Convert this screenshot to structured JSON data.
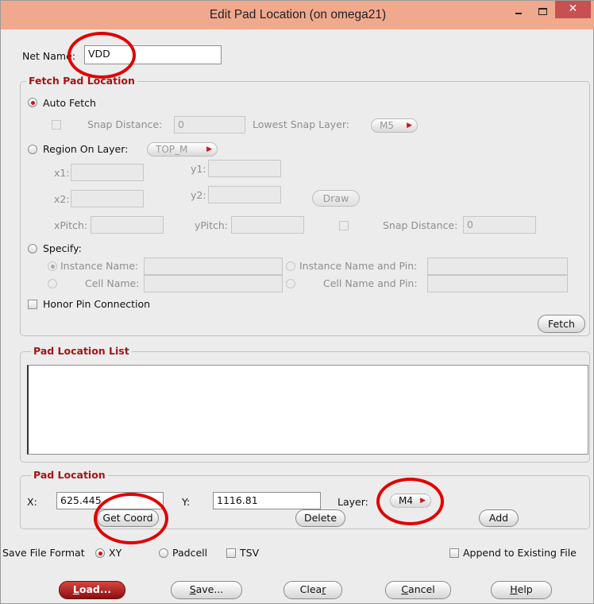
{
  "window": {
    "title": "Edit Pad Location (on omega21)",
    "close_glyph": "✕"
  },
  "net_name": {
    "label": "Net Name:",
    "value": "VDD"
  },
  "fetch_group": {
    "title": "Fetch Pad Location",
    "auto_fetch": {
      "label": "Auto Fetch",
      "selected": true
    },
    "snap_distance": {
      "label": "Snap Distance:",
      "value": "0"
    },
    "lowest_snap_layer": {
      "label": "Lowest Snap Layer:",
      "value": "M5"
    },
    "region_on_layer": {
      "label": "Region On Layer:",
      "value": "TOP_M"
    },
    "x1": "x1:",
    "y1": "y1:",
    "x2": "x2:",
    "y2": "y2:",
    "draw_label": "Draw",
    "xpitch": "xPitch:",
    "ypitch": "yPitch:",
    "snap_distance2": {
      "label": "Snap Distance:",
      "value": "0"
    },
    "specify": "Specify:",
    "instance_name": "Instance Name:",
    "instance_name_and_pin": "Instance Name and Pin:",
    "cell_name": "Cell Name:",
    "cell_name_and_pin": "Cell Name and Pin:",
    "honor_pin": "Honor Pin Connection",
    "fetch_label": "Fetch"
  },
  "pad_location_list": {
    "title": "Pad Location List"
  },
  "pad_location": {
    "title": "Pad Location",
    "x_label": "X:",
    "x_value": "625.445",
    "y_label": "Y:",
    "y_value": "1116.81",
    "layer_label": "Layer:",
    "layer_value": "M4",
    "get_coord": "Get Coord",
    "delete": "Delete",
    "add": "Add"
  },
  "save_format": {
    "label": "Save File Format",
    "options": [
      "XY",
      "Padcell",
      "TSV"
    ],
    "selected": "XY",
    "append": "Append to Existing File"
  },
  "bottom_buttons": {
    "load_u": "L",
    "load_rest": "oad...",
    "save_u": "S",
    "save_rest": "ave...",
    "clear_pre": "Clea",
    "clear_u": "r",
    "cancel_u": "C",
    "cancel_rest": "ancel",
    "help_u": "H",
    "help_rest": "elp"
  },
  "colors": {
    "title_bar": "#f0a98d",
    "accent_red": "#c8141a",
    "group_title": "#a31515",
    "annotation": "#e10000"
  }
}
